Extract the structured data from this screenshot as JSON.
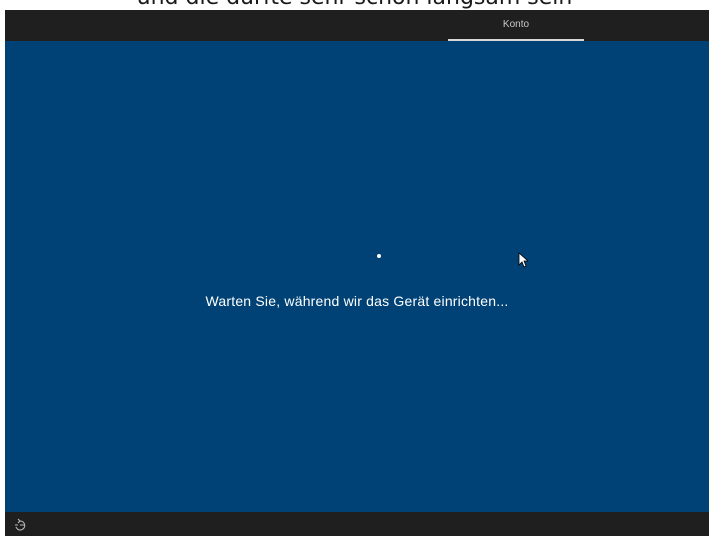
{
  "caption": {
    "text": "und die dürfte sehr schön langsam sein"
  },
  "top_bar": {
    "active_tab": "Konto"
  },
  "main": {
    "status_text": "Warten Sie, während wir das Gerät einrichten..."
  },
  "bottom_bar": {
    "ease_of_access_icon": "ease-of-access-icon"
  },
  "colors": {
    "background_blue": "#004275",
    "bar_dark": "#1f1f1f"
  }
}
